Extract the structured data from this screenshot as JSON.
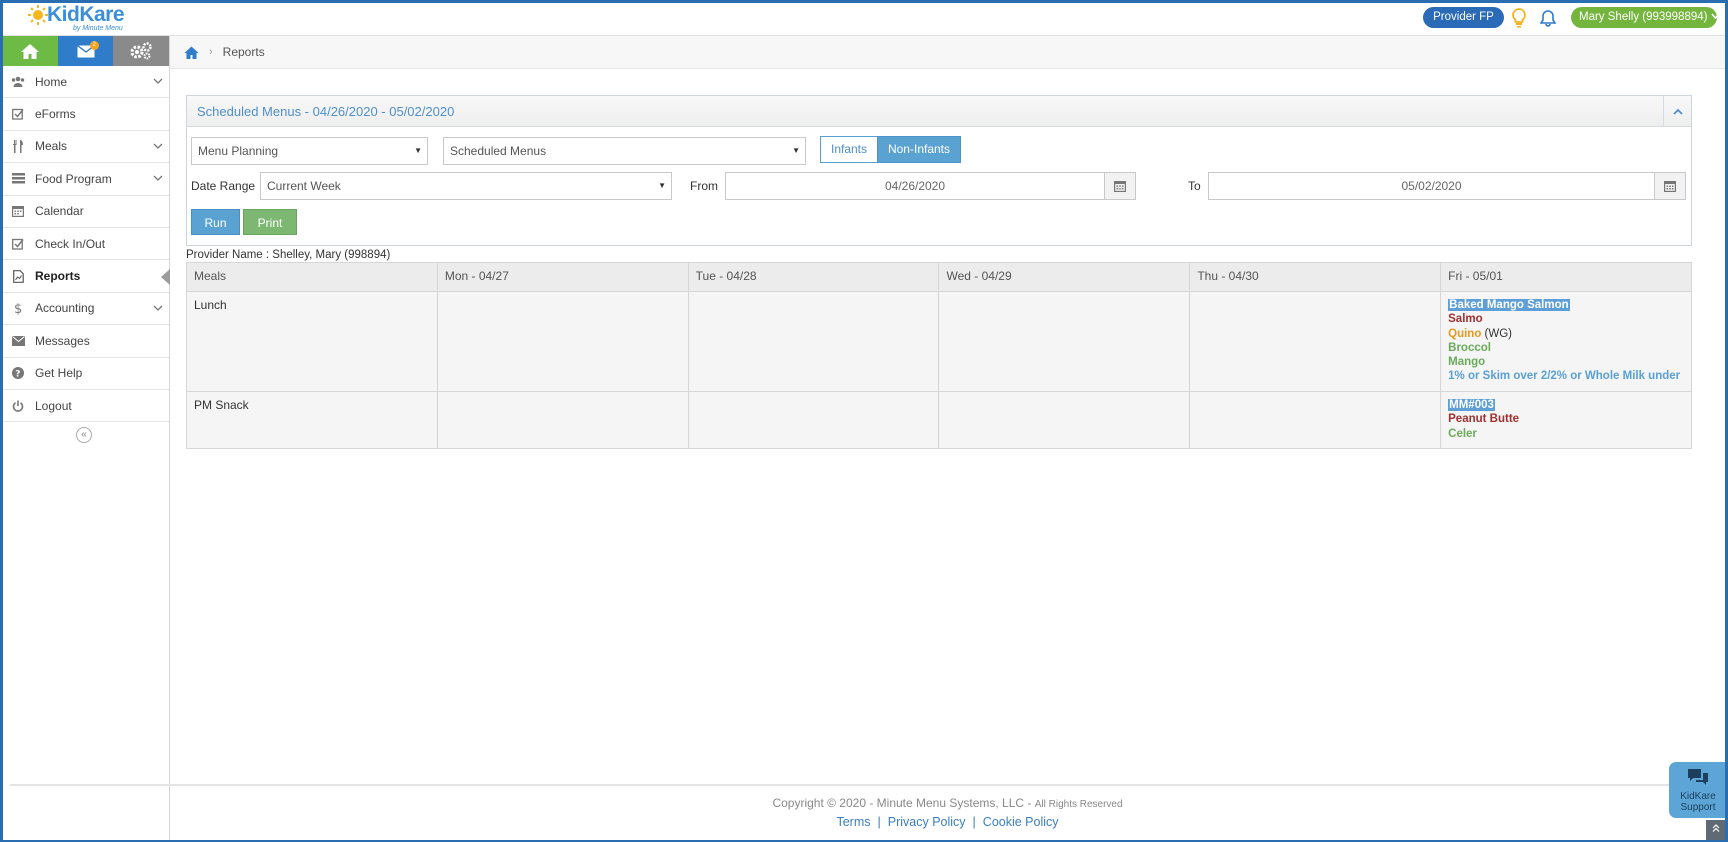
{
  "brand": {
    "name": "KidKare",
    "tagline": "by Minute Menu"
  },
  "header": {
    "provider_btn": "Provider FP",
    "user_menu": "Mary Shelly (993998894)"
  },
  "iconbar": {
    "mail_badge": "2"
  },
  "sidebar": {
    "items": [
      {
        "label": "Home",
        "icon": "users-icon",
        "expandable": true
      },
      {
        "label": "eForms",
        "icon": "check-square-icon",
        "expandable": false
      },
      {
        "label": "Meals",
        "icon": "utensils-icon",
        "expandable": true
      },
      {
        "label": "Food Program",
        "icon": "tray-icon",
        "expandable": true
      },
      {
        "label": "Calendar",
        "icon": "calendar-icon",
        "expandable": false
      },
      {
        "label": "Check In/Out",
        "icon": "check-square-icon",
        "expandable": false
      },
      {
        "label": "Reports",
        "icon": "report-icon",
        "expandable": false,
        "active": true
      },
      {
        "label": "Accounting",
        "icon": "dollar-icon",
        "expandable": true
      },
      {
        "label": "Messages",
        "icon": "envelope-icon",
        "expandable": false
      },
      {
        "label": "Get Help",
        "icon": "question-icon",
        "expandable": false
      },
      {
        "label": "Logout",
        "icon": "power-icon",
        "expandable": false
      }
    ],
    "collapse_glyph": "«"
  },
  "breadcrumb": {
    "current": "Reports"
  },
  "report": {
    "title": "Scheduled Menus - 04/26/2020 - 05/02/2020",
    "category_select": "Menu Planning",
    "report_select": "Scheduled Menus",
    "toggle_infants": "Infants",
    "toggle_noninfants": "Non-Infants",
    "date_range_label": "Date Range",
    "date_range_value": "Current Week",
    "from_label": "From",
    "from_value": "04/26/2020",
    "to_label": "To",
    "to_value": "05/02/2020",
    "run_label": "Run",
    "print_label": "Print"
  },
  "provider_line": "Provider Name : Shelley, Mary (998894)",
  "table": {
    "headers": [
      "Meals",
      "Mon - 04/27",
      "Tue - 04/28",
      "Wed - 04/29",
      "Thu - 04/30",
      "Fri - 05/01"
    ],
    "rows": [
      {
        "meal": "Lunch",
        "fri": {
          "title": "Baked Mango Salmon",
          "items": [
            {
              "text": "Salmo",
              "color": "#a03030"
            },
            {
              "text": "Quino",
              "suffix": " (WG)",
              "color": "#e79a1f"
            },
            {
              "text": "Broccol",
              "color": "#6aab5b"
            },
            {
              "text": "Mango",
              "color": "#6aab5b"
            },
            {
              "text": "1% or Skim over 2/2% or Whole Milk under",
              "color": "#5aa0d2"
            }
          ]
        }
      },
      {
        "meal": "PM Snack",
        "fri": {
          "title": "MM#003",
          "items": [
            {
              "text": "Peanut Butte",
              "color": "#a03030"
            },
            {
              "text": "Celer",
              "color": "#6aab5b"
            }
          ]
        }
      }
    ]
  },
  "footer": {
    "copyright": "Copyright © 2020 - Minute Menu Systems, LLC -",
    "rights": "All Rights Reserved",
    "links": [
      "Terms",
      "Privacy Policy",
      "Cookie Policy"
    ]
  },
  "support": {
    "line1": "KidKare",
    "line2": "Support"
  },
  "colors": {
    "primary": "#2f7ccb",
    "green": "#74b53e",
    "accent": "#5aa2d2"
  }
}
